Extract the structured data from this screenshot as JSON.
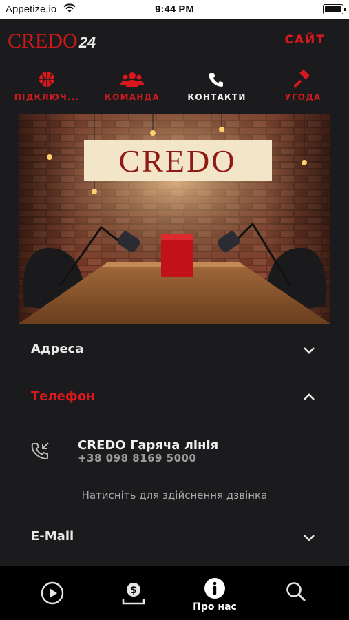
{
  "status_bar": {
    "carrier": "Appetize.io",
    "time": "9:44 PM"
  },
  "header": {
    "logo_text": "CREDO",
    "logo_number": "24",
    "site_link": "САЙТ"
  },
  "tabs": [
    {
      "label": "ПІДКЛЮЧ...",
      "icon": "basketball-icon",
      "active": false
    },
    {
      "label": "КОМАНДА",
      "icon": "team-icon",
      "active": false
    },
    {
      "label": "КОНТАКТИ",
      "icon": "phone-icon",
      "active": true
    },
    {
      "label": "УГОДА",
      "icon": "gavel-icon",
      "active": false
    }
  ],
  "hero": {
    "sign_text": "CREDO"
  },
  "sections": {
    "address": {
      "title": "Адреса",
      "expanded": false
    },
    "phone": {
      "title": "Телефон",
      "expanded": true
    },
    "email": {
      "title": "E-Mail",
      "expanded": false
    }
  },
  "phone_entry": {
    "name": "CREDO Гаряча лінія",
    "number": "+38 098 8169 5000"
  },
  "call_hint": "Натисніть для здійснення дзвінка",
  "bottom_tabs": [
    {
      "icon": "play-icon",
      "label": ""
    },
    {
      "icon": "money-icon",
      "label": ""
    },
    {
      "icon": "info-icon",
      "label": "Про нас",
      "active": true
    },
    {
      "icon": "search-icon",
      "label": ""
    }
  ],
  "colors": {
    "accent": "#d8181d",
    "background": "#1b1b1d",
    "tabbar": "#000000"
  }
}
